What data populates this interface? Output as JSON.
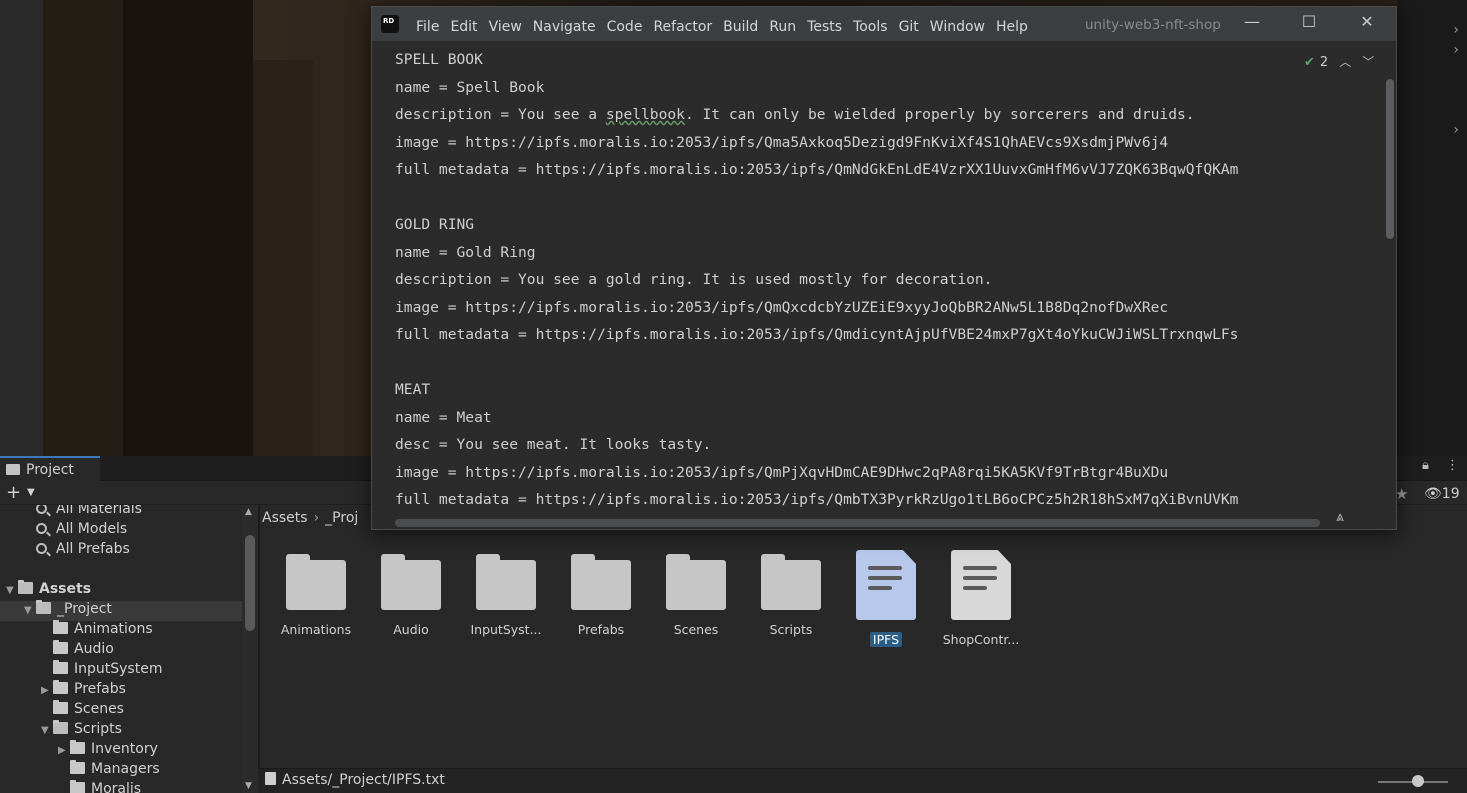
{
  "rider": {
    "menu": [
      "File",
      "Edit",
      "View",
      "Navigate",
      "Code",
      "Refactor",
      "Build",
      "Run",
      "Tests",
      "Tools",
      "Git",
      "Window",
      "Help"
    ],
    "project_name": "unity-web3-nft-shop",
    "inspection_count": "2",
    "lines": [
      "SPELL BOOK",
      "name = Spell Book",
      "description = You see a spellbook. It can only be wielded properly by sorcerers and druids.",
      "image = https://ipfs.moralis.io:2053/ipfs/Qma5Axkoq5Dezigd9FnKviXf4S1QhAEVcs9XsdmjPWv6j4",
      "full metadata = https://ipfs.moralis.io:2053/ipfs/QmNdGkEnLdE4VzrXX1UuvxGmHfM6vVJ7ZQK63BqwQfQKAm",
      "",
      "GOLD RING",
      "name = Gold Ring",
      "description = You see a gold ring. It is used mostly for decoration.",
      "image = https://ipfs.moralis.io:2053/ipfs/QmQxcdcbYzUZEiE9xyyJoQbBR2ANw5L1B8Dq2nofDwXRec",
      "full metadata = https://ipfs.moralis.io:2053/ipfs/QmdicyntAjpUfVBE24mxP7gXt4oYkuCWJiWSLTrxnqwLFs",
      "",
      "MEAT",
      "name = Meat",
      "desc = You see meat. It looks tasty.",
      "image = https://ipfs.moralis.io:2053/ipfs/QmPjXqvHDmCAE9DHwc2qPA8rqi5KA5KVf9TrBtgr4BuXDu",
      "full metadata = https://ipfs.moralis.io:2053/ipfs/QmbTX3PyrkRzUgo1tLB6oCPCz5h2R18hSxM7qXiBvnUVKm"
    ],
    "squiggle_word": "spellbook"
  },
  "project": {
    "tab_label": "Project",
    "hidden_count": "19",
    "tree": [
      {
        "label": "All Materials",
        "indent": 1,
        "icon": "search-icon",
        "arrow": ""
      },
      {
        "label": "All Models",
        "indent": 1,
        "icon": "search-icon",
        "arrow": ""
      },
      {
        "label": "All Prefabs",
        "indent": 1,
        "icon": "search-icon",
        "arrow": ""
      },
      {
        "label": "",
        "indent": 0,
        "icon": "",
        "arrow": ""
      },
      {
        "label": "Assets",
        "indent": 0,
        "icon": "folder-open-icon",
        "arrow": "▼",
        "bold": true
      },
      {
        "label": "_Project",
        "indent": 1,
        "icon": "folder-open-icon",
        "arrow": "▼",
        "selected": true
      },
      {
        "label": "Animations",
        "indent": 2,
        "icon": "folder-icon",
        "arrow": ""
      },
      {
        "label": "Audio",
        "indent": 2,
        "icon": "folder-icon",
        "arrow": ""
      },
      {
        "label": "InputSystem",
        "indent": 2,
        "icon": "folder-icon",
        "arrow": ""
      },
      {
        "label": "Prefabs",
        "indent": 2,
        "icon": "folder-icon",
        "arrow": "▶"
      },
      {
        "label": "Scenes",
        "indent": 2,
        "icon": "folder-icon",
        "arrow": ""
      },
      {
        "label": "Scripts",
        "indent": 2,
        "icon": "folder-open-icon",
        "arrow": "▼"
      },
      {
        "label": "Inventory",
        "indent": 3,
        "icon": "folder-icon",
        "arrow": "▶"
      },
      {
        "label": "Managers",
        "indent": 3,
        "icon": "folder-icon",
        "arrow": ""
      },
      {
        "label": "Moralis",
        "indent": 3,
        "icon": "folder-icon",
        "arrow": ""
      }
    ],
    "breadcrumb": [
      "Assets",
      "_Proj"
    ],
    "assets": [
      {
        "label": "Animations",
        "type": "folder"
      },
      {
        "label": "Audio",
        "type": "folder"
      },
      {
        "label": "InputSyst...",
        "type": "folder"
      },
      {
        "label": "Prefabs",
        "type": "folder"
      },
      {
        "label": "Scenes",
        "type": "folder"
      },
      {
        "label": "Scripts",
        "type": "folder"
      },
      {
        "label": "IPFS",
        "type": "text",
        "selected": true
      },
      {
        "label": "ShopContr...",
        "type": "text"
      }
    ],
    "status_path": "Assets/_Project/IPFS.txt"
  }
}
